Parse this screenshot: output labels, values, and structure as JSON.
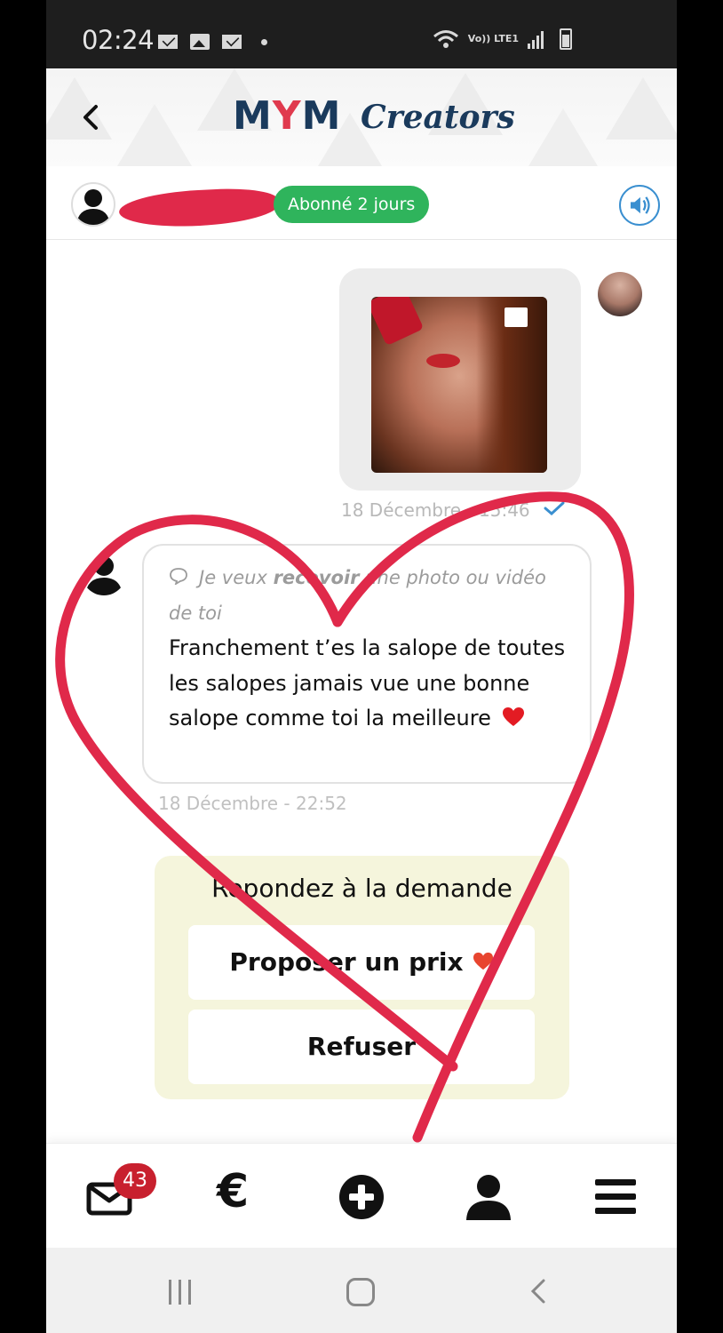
{
  "status_bar": {
    "time": "02:24",
    "network": "Vo)) LTE1",
    "icons": [
      "mail-icon",
      "image-icon",
      "mail-icon",
      "dot-icon",
      "wifi-icon",
      "signal-icon",
      "battery-icon"
    ]
  },
  "header": {
    "logo_m1": "M",
    "logo_y": "Y",
    "logo_m2": "M",
    "logo_sub": "Creators",
    "colors": {
      "navy": "#1a3a5c",
      "red": "#e03a4e"
    }
  },
  "conversation": {
    "subscription_badge": "Abonné 2 jours",
    "badge_color": "#2fb45c"
  },
  "messages": [
    {
      "type": "media",
      "from": "creator",
      "timestamp": "18 Décembre - 15:46",
      "read": true
    },
    {
      "type": "request",
      "from": "subscriber",
      "request_prefix": "Je veux ",
      "request_bold": "recevoir",
      "request_suffix": " une photo ou vidéo de toi",
      "body": "Franchement t’es la salope de toutes les salopes jamais vue une bonne salope comme toi la meilleure",
      "body_emoji": "❤️",
      "timestamp": "18 Décembre - 22:52"
    }
  ],
  "respond": {
    "title": "Repondez à la demande",
    "propose_label": "Proposer un prix",
    "refuse_label": "Refuser",
    "bg_color": "#f5f5dc"
  },
  "bottom_nav": {
    "unread_count": "43",
    "euro_label": "€",
    "items": [
      "messages-icon",
      "euro-icon",
      "plus-icon",
      "profile-icon",
      "menu-icon"
    ]
  },
  "overlay": {
    "scribble_color": "#e0294a"
  }
}
